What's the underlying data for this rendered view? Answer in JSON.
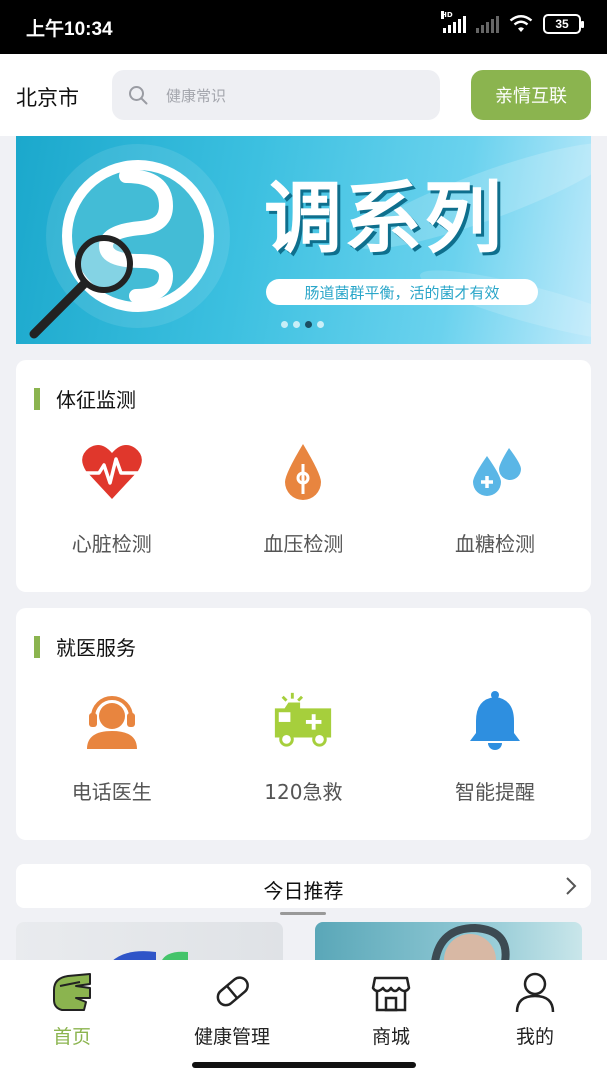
{
  "status": {
    "time": "上午10:34",
    "battery": "35",
    "network": "HD"
  },
  "header": {
    "city": "北京市",
    "search_placeholder": "健康常识",
    "family_button": "亲情互联"
  },
  "banner": {
    "title": "调系列",
    "subtitle": "肠道菌群平衡，活的菌才有效",
    "dot_count": 4,
    "active_dot": 3
  },
  "vital": {
    "title": "体征监测",
    "items": [
      {
        "label": "心脏检测",
        "icon": "heart-pulse-icon",
        "color": "#e0372c"
      },
      {
        "label": "血压检测",
        "icon": "blood-drop-icon",
        "color": "#e8853f"
      },
      {
        "label": "血糖检测",
        "icon": "glucose-drops-icon",
        "color": "#5ab6e6"
      }
    ]
  },
  "medical": {
    "title": "就医服务",
    "items": [
      {
        "label": "电话医生",
        "icon": "doctor-headset-icon",
        "color": "#e8853f"
      },
      {
        "label": "120急救",
        "icon": "ambulance-icon",
        "color": "#a6cf3c"
      },
      {
        "label": "智能提醒",
        "icon": "bell-icon",
        "color": "#2e8fe0"
      }
    ]
  },
  "recommend": {
    "title": "今日推荐"
  },
  "tabs": [
    {
      "label": "首页",
      "icon": "home-hand-icon",
      "active": true
    },
    {
      "label": "健康管理",
      "icon": "pill-icon",
      "active": false
    },
    {
      "label": "商城",
      "icon": "store-icon",
      "active": false
    },
    {
      "label": "我的",
      "icon": "user-icon",
      "active": false
    }
  ],
  "colors": {
    "accent": "#8bb44f",
    "background": "#f0f1f5"
  }
}
